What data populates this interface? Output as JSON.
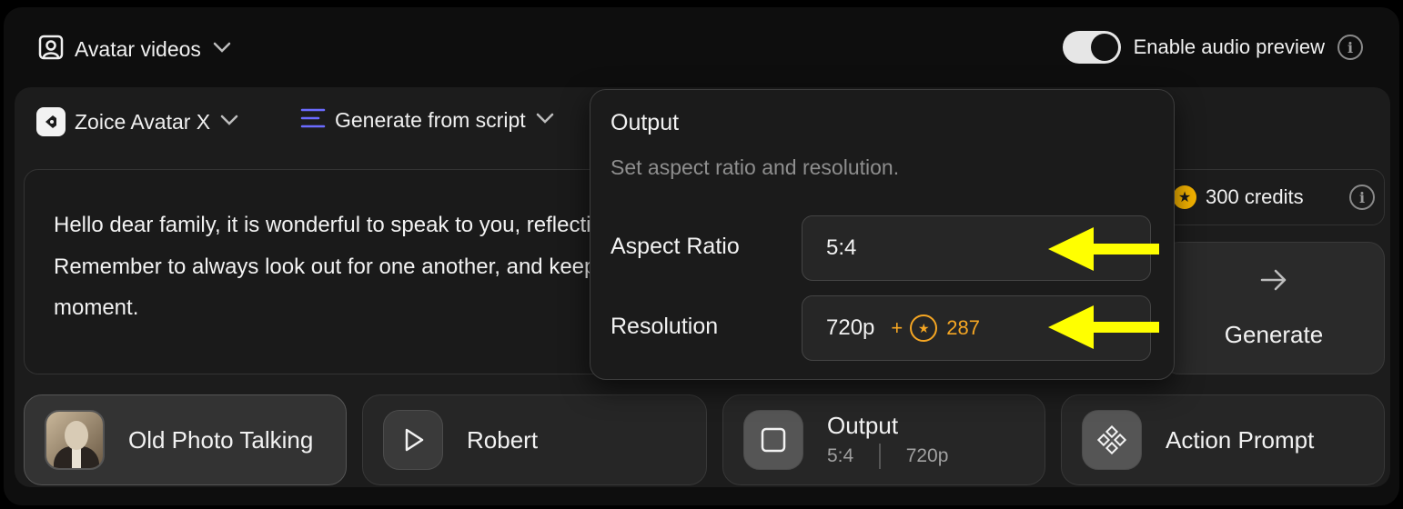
{
  "header": {
    "mode_label": "Avatar videos",
    "audio_preview_label": "Enable audio preview",
    "audio_preview_enabled": true
  },
  "toolbar": {
    "model_label": "Zoice Avatar X",
    "source_label": "Generate from script"
  },
  "script": {
    "text": "Hello dear family, it is wonderful to speak to you, reflecting on our history and sharing these memories today. Remember to always look out for one another, and keep our family traditions alive, and cherish every single moment."
  },
  "credits": {
    "label": "300 credits"
  },
  "generate": {
    "label": "Generate"
  },
  "cards": {
    "photo": {
      "label": "Old Photo Talking"
    },
    "voice": {
      "label": "Robert"
    },
    "output": {
      "label": "Output",
      "ratio": "5:4",
      "resolution": "720p"
    },
    "action": {
      "label": "Action Prompt"
    }
  },
  "popover": {
    "title": "Output",
    "subtitle": "Set aspect ratio and resolution.",
    "aspect_label": "Aspect Ratio",
    "aspect_value": "5:4",
    "resolution_label": "Resolution",
    "resolution_value": "720p",
    "resolution_plus": "+",
    "resolution_cost": "287"
  },
  "colors": {
    "accent_orange": "#f5a623",
    "annotation_arrow": "#ffff00",
    "source_icon": "#6b6bff"
  }
}
